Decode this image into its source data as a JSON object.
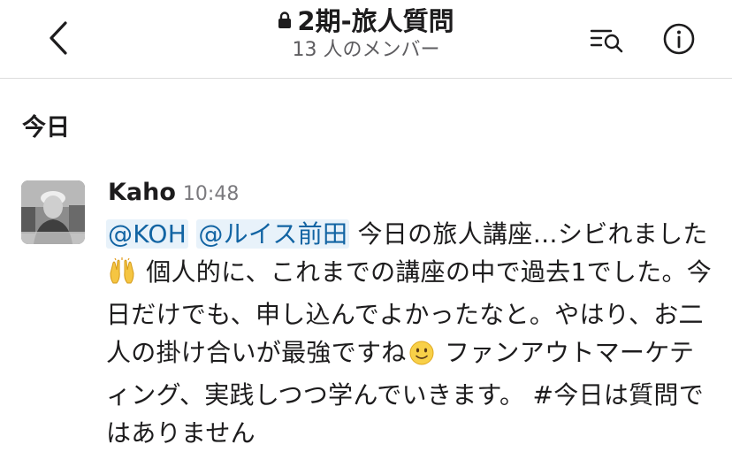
{
  "header": {
    "title": "2期-旅人質問",
    "subtitle": "13 人のメンバー",
    "back_icon": "chevron-left-icon",
    "lock_icon": "lock-icon",
    "search_icon": "search-list-icon",
    "info_icon": "info-icon"
  },
  "day_divider": {
    "label": "今日"
  },
  "message": {
    "author": "Kaho",
    "time": "10:48",
    "mentions": [
      "@KOH",
      "@ルイス前田"
    ],
    "text_part1": "今日の旅人講座…シビれました",
    "emoji1": "raising-hands-emoji",
    "text_part2": "個人的に、これまでの講座の中で過去1でした。今日だけでも、申し込んでよかったなと。やはり、お二人の掛け合いが最強ですね",
    "emoji2": "slightly-smiling-face-emoji",
    "text_part3": "ファンアウトマーケティング、実践しつつ学んでいきます。 #今日は質問ではありません"
  },
  "colors": {
    "mention_bg": "#e8f2fa",
    "mention_text": "#1264a3",
    "header_border": "#dddddd",
    "muted_text": "#5e5d60"
  }
}
